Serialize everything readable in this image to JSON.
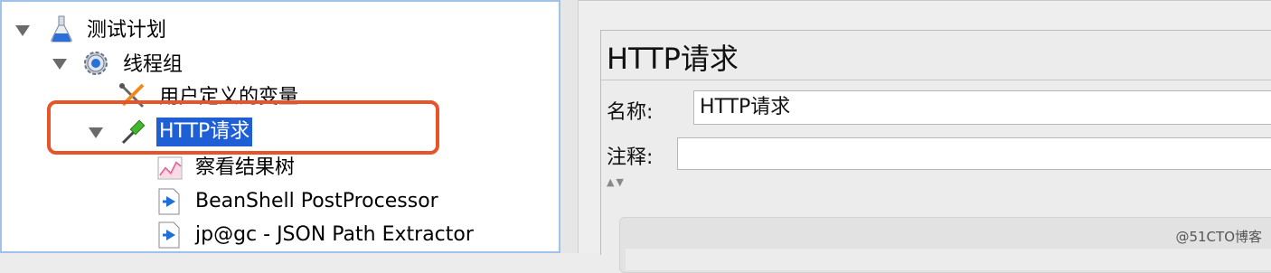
{
  "tree": {
    "items": [
      {
        "label": "测试计划",
        "icon": "flask-icon"
      },
      {
        "label": "线程组",
        "icon": "gear-icon"
      },
      {
        "label": "用户定义的变量",
        "icon": "tools-icon"
      },
      {
        "label": "HTTP请求",
        "icon": "pipette-icon",
        "selected": true
      },
      {
        "label": "察看结果树",
        "icon": "chart-icon"
      },
      {
        "label": "BeanShell PostProcessor",
        "icon": "postprocessor-icon"
      },
      {
        "label": "jp@gc - JSON Path Extractor",
        "icon": "postprocessor-icon"
      }
    ]
  },
  "editor": {
    "title": "HTTP请求",
    "name_label": "名称:",
    "name_value": "HTTP请求",
    "comment_label": "注释:",
    "comment_value": ""
  },
  "colors": {
    "selection": "#1f5fd6",
    "highlight": "#e8542a"
  },
  "watermark": "@51CTO博客"
}
